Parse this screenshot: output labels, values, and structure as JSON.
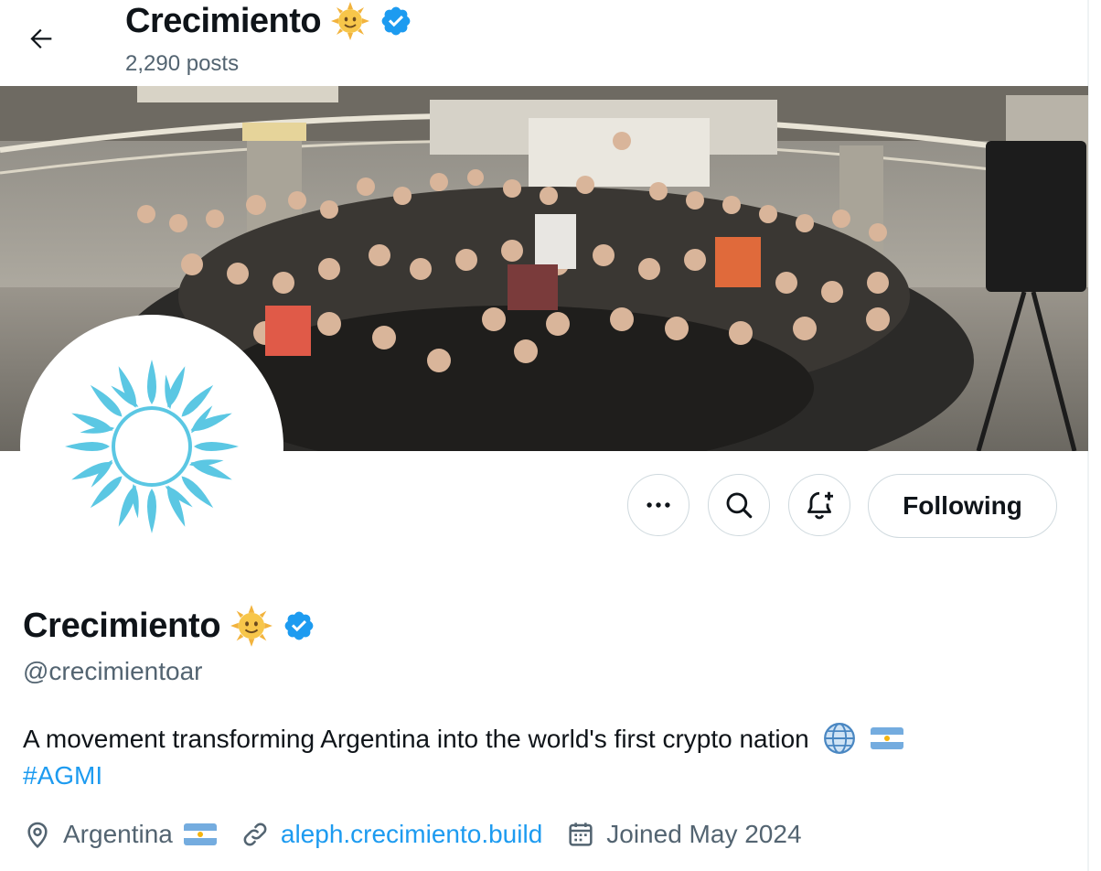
{
  "header": {
    "title": "Crecimiento",
    "posts_count": "2,290 posts",
    "back_icon": "arrow-left-icon",
    "sun_emoji_icon": "sun-with-face-icon",
    "verified_icon": "verified-badge-icon"
  },
  "banner": {
    "icon": "group-photo-banner"
  },
  "avatar": {
    "icon": "sun-logo-icon",
    "color": "#5bc7e3"
  },
  "actions": {
    "more_icon": "more-dots-icon",
    "search_icon": "search-icon",
    "notify_icon": "bell-plus-icon",
    "follow_label": "Following"
  },
  "profile": {
    "name": "Crecimiento",
    "handle": "@crecimientoar",
    "bio": "A movement transforming Argentina into the world's first crypto nation",
    "bio_icons": [
      "globe-icon",
      "argentina-flag-icon"
    ],
    "hashtag": "#AGMI",
    "location": "Argentina",
    "website": "aleph.crecimiento.build",
    "joined": "Joined May 2024"
  },
  "colors": {
    "accent": "#1d9bf0",
    "secondary_text": "#536471",
    "verified": "#1d9bf0",
    "flag_blue": "#74acdf",
    "flag_sun": "#f6b40e"
  }
}
